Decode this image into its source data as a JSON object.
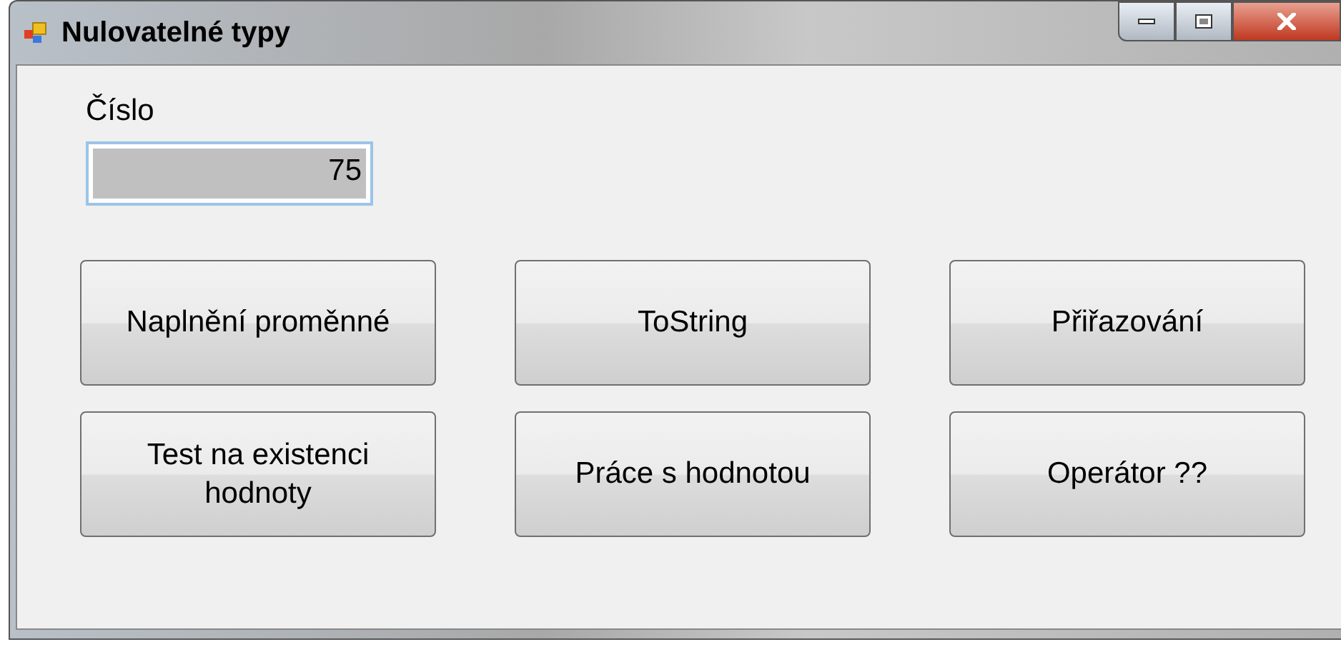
{
  "window": {
    "title": "Nulovatelné typy"
  },
  "label": "Číslo",
  "field": {
    "value": "75"
  },
  "buttons": [
    {
      "label": "Naplnění proměnné"
    },
    {
      "label": "ToString"
    },
    {
      "label": "Přiřazování"
    },
    {
      "label": "Test na existenci hodnoty"
    },
    {
      "label": "Práce s hodnotou"
    },
    {
      "label": "Operátor ??"
    }
  ]
}
